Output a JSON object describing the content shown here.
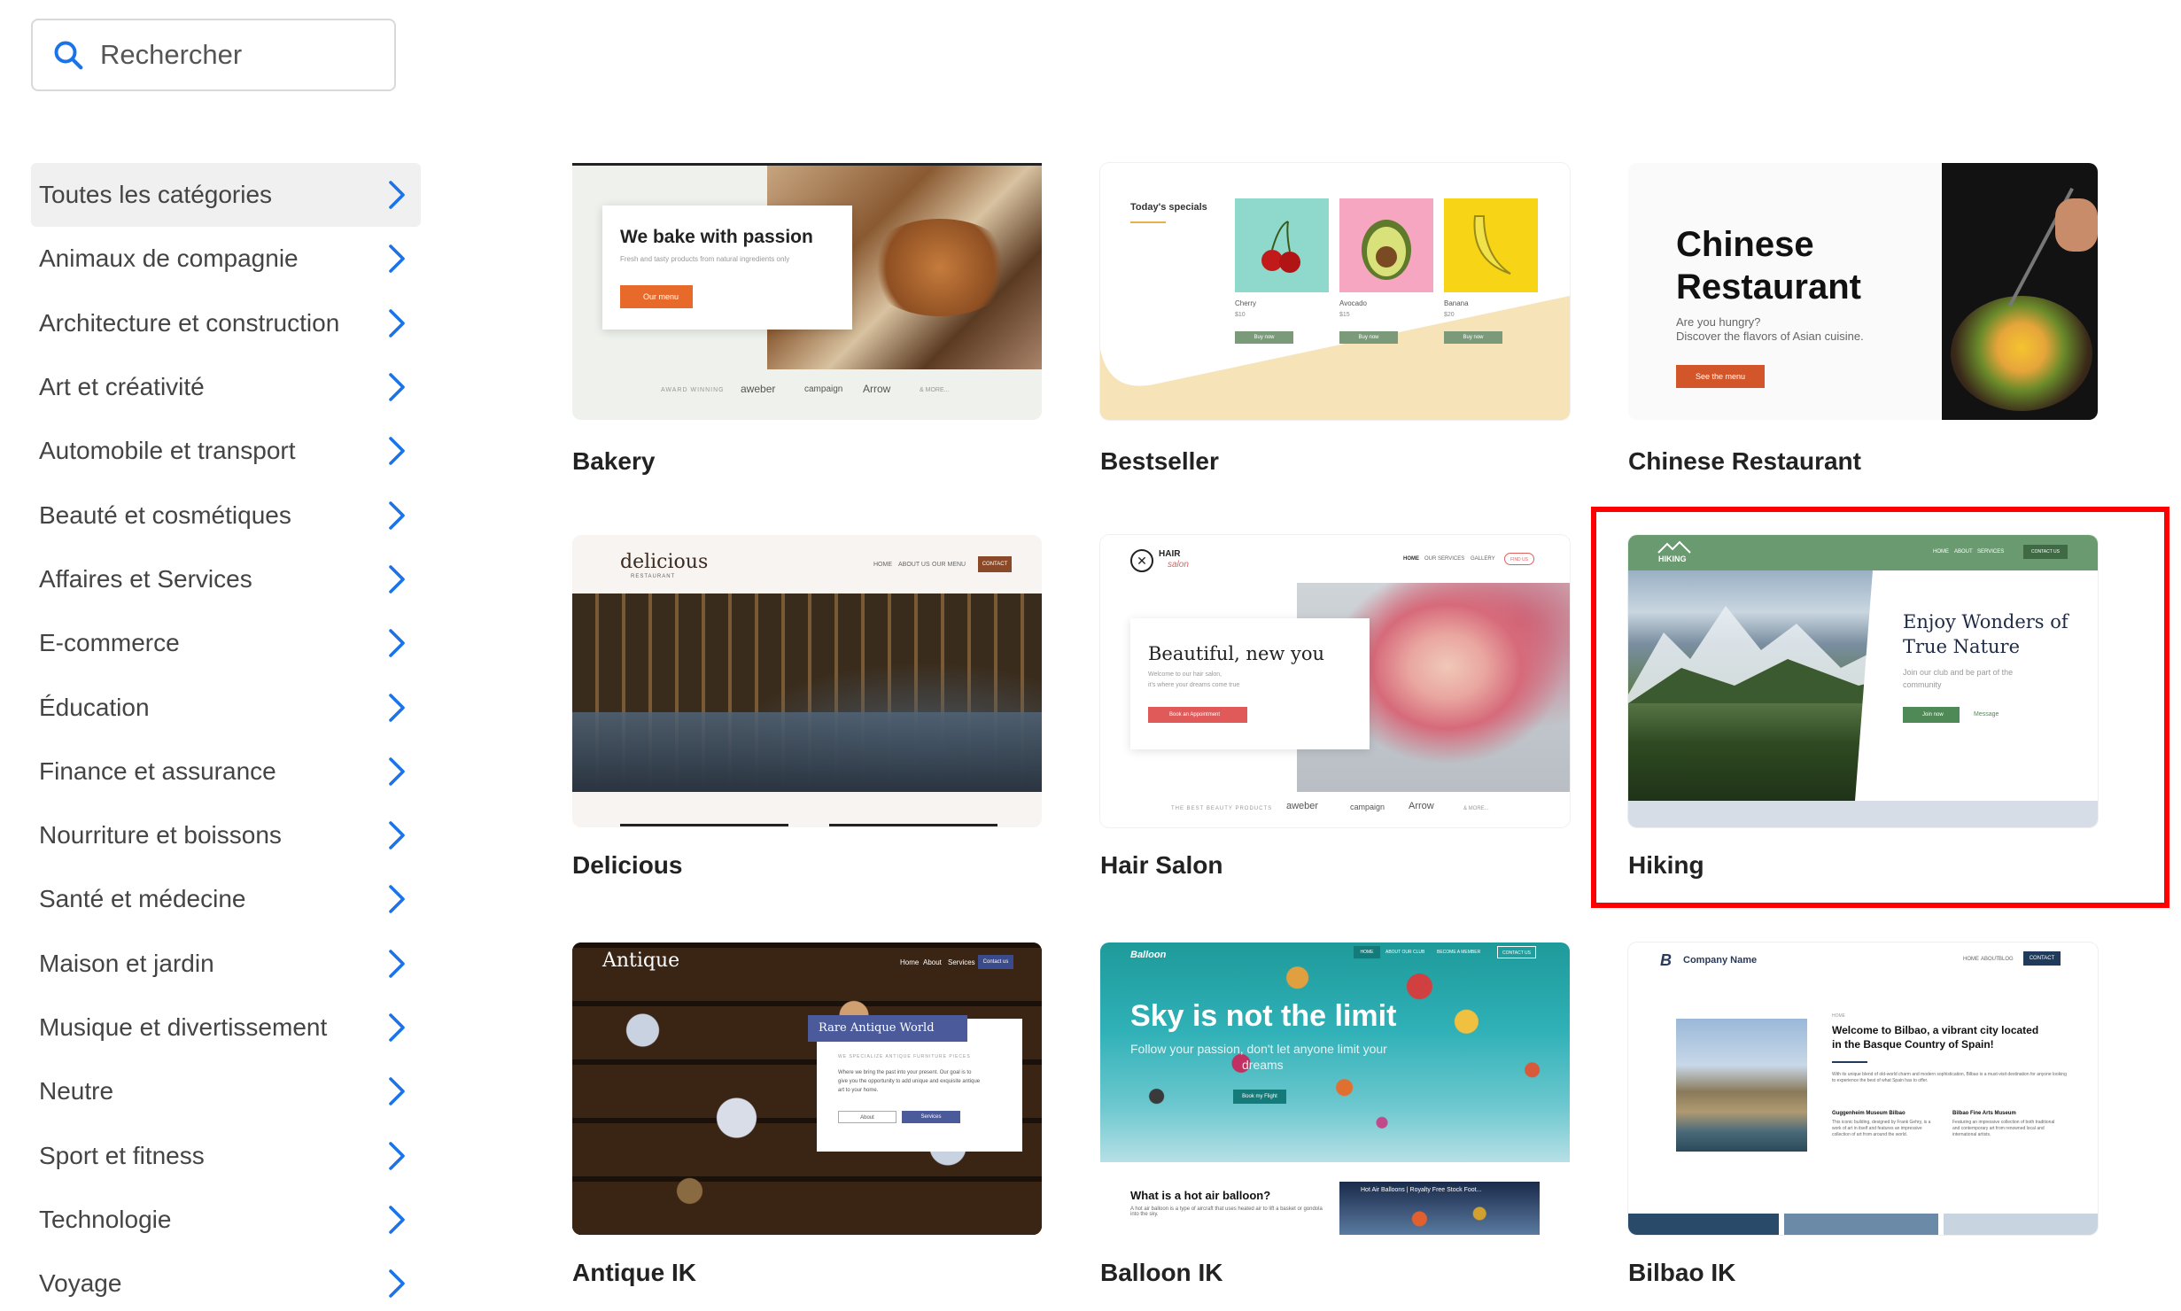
{
  "search": {
    "placeholder": "Rechercher"
  },
  "categories": [
    "Toutes les catégories",
    "Animaux de compagnie",
    "Architecture et construction",
    "Art et créativité",
    "Automobile et transport",
    "Beauté et cosmétiques",
    "Affaires et Services",
    "E-commerce",
    "Éducation",
    "Finance et assurance",
    "Nourriture et boissons",
    "Santé et médecine",
    "Maison et jardin",
    "Musique et divertissement",
    "Neutre",
    "Sport et fitness",
    "Technologie",
    "Voyage"
  ],
  "active_category": "Toutes les catégories",
  "templates": [
    {
      "title": "Bakery",
      "preview": {
        "headline": "We bake with passion",
        "sub": "Fresh and tasty products from natural ingredients only",
        "button": "Our menu",
        "strip": [
          "AWARD WINNING",
          "aweber",
          "campaign",
          "Arrow",
          "& MORE..."
        ]
      }
    },
    {
      "title": "Bestseller",
      "preview": {
        "heading": "Today's specials",
        "items": [
          {
            "name": "Cherry",
            "price": "$10",
            "button": "Buy now"
          },
          {
            "name": "Avocado",
            "price": "$15",
            "button": "Buy now"
          },
          {
            "name": "Banana",
            "price": "$20",
            "button": "Buy now"
          }
        ]
      }
    },
    {
      "title": "Chinese Restaurant",
      "preview": {
        "headline_1": "Chinese",
        "headline_2": "Restaurant",
        "sub_1": "Are you hungry?",
        "sub_2": "Discover the flavors of Asian cuisine.",
        "button": "See the menu"
      }
    },
    {
      "title": "Delicious",
      "preview": {
        "logo": "delicious",
        "logo_sub": "RESTAURANT",
        "nav": [
          "HOME",
          "ABOUT US",
          "OUR MENU",
          "CONTACT"
        ]
      }
    },
    {
      "title": "Hair Salon",
      "preview": {
        "logo": "HAIR",
        "logo_script": "salon",
        "nav": [
          "HOME",
          "OUR SERVICES",
          "GALLERY",
          "FIND US"
        ],
        "headline": "Beautiful, new you",
        "sub_1": "Welcome to our hair salon,",
        "sub_2": "it's where your dreams come true",
        "button": "Book an Appointment",
        "strip": [
          "THE BEST BEAUTY PRODUCTS",
          "aweber",
          "campaign",
          "Arrow",
          "& MORE..."
        ]
      }
    },
    {
      "title": "Hiking",
      "selected": true,
      "preview": {
        "logo": "HIKING",
        "nav": [
          "HOME",
          "ABOUT",
          "SERVICES",
          "CONTACT US"
        ],
        "headline_1": "Enjoy Wonders of",
        "headline_2": "True Nature",
        "sub_1": "Join our club and be part of the",
        "sub_2": "community",
        "button": "Join now",
        "link": "Message"
      }
    },
    {
      "title": "Antique IK",
      "preview": {
        "logo": "Antique",
        "nav": [
          "Home",
          "About",
          "Services",
          "Contact us"
        ],
        "box_title": "Rare Antique World",
        "box_label": "WE SPECIALIZE ANTIQUE FURNITURE PIECES",
        "box_text_1": "Where we bring the past into your present. Our goal is to",
        "box_text_2": "give you the opportunity to add unique and exquisite antique",
        "box_text_3": "art to your home.",
        "btn_1": "About",
        "btn_2": "Services"
      }
    },
    {
      "title": "Balloon IK",
      "preview": {
        "logo": "Balloon",
        "nav": [
          "HOME",
          "ABOUT OUR CLUB",
          "BECOME A MEMBER",
          "CONTACT US"
        ],
        "headline": "Sky is not the limit",
        "sub_1": "Follow your passion, don't let anyone limit your",
        "sub_2": "dreams",
        "button": "Book my Flight",
        "question": "What is a hot air balloon?",
        "answer": "A hot air balloon is a type of aircraft that uses heated air to lift a basket or gondola into the sky.",
        "video": "Hot Air Balloons | Royalty Free Stock Foot..."
      }
    },
    {
      "title": "Bilbao IK",
      "preview": {
        "logo": "Company Name",
        "nav": [
          "HOME",
          "ABOUT",
          "BLOG",
          "CONTACT"
        ],
        "kicker": "HOME",
        "headline_1": "Welcome to Bilbao, a vibrant city located",
        "headline_2": "in the Basque Country of Spain!",
        "body": "With its unique blend of old-world charm and modern sophistication, Bilbao is a must-visit destination for anyone looking to experience the best of what Spain has to offer.",
        "col_1_title": "Guggenheim Museum Bilbao",
        "col_2_title": "Bilbao Fine Arts Museum",
        "col_1": "This iconic building, designed by Frank Gehry, is a work of art in itself and features an impressive collection of art from around the world.",
        "col_2": "Featuring an impressive collection of both traditional and contemporary art from renowned local and international artists."
      }
    }
  ],
  "colors": {
    "accent": "#1a73e8",
    "selection": "#ff0000",
    "orange": "#e86a2a",
    "hiking_green": "#6a9a6f"
  }
}
